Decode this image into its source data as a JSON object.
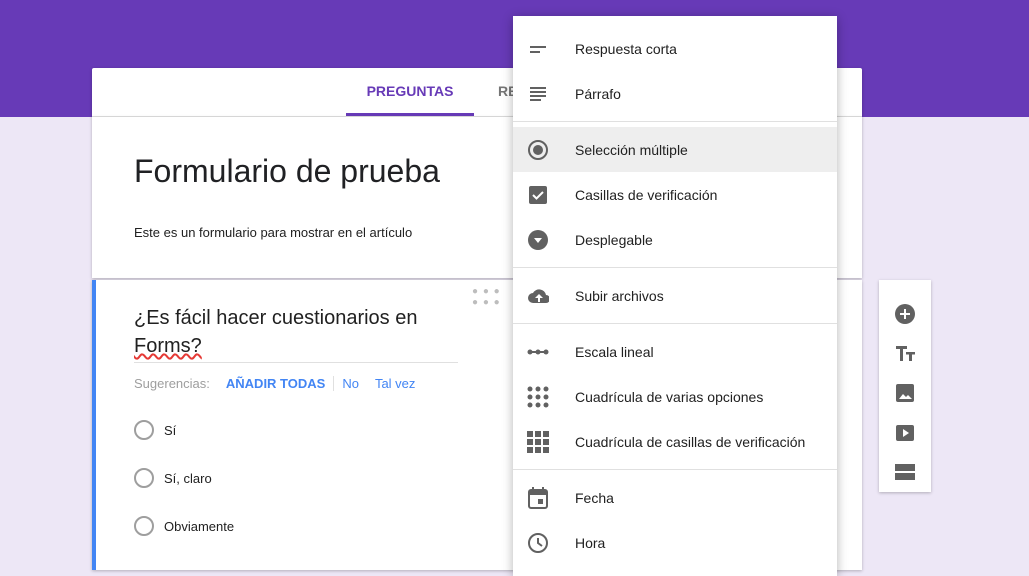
{
  "tabs": {
    "questions": "PREGUNTAS",
    "responses": "RE"
  },
  "form": {
    "title": "Formulario de prueba",
    "description": "Este es un formulario para mostrar en el artículo"
  },
  "question": {
    "title_part1": "¿Es fácil hacer cuestionarios en ",
    "title_part2": "Forms?",
    "suggestions_label": "Sugerencias:",
    "add_all": "AÑADIR TODAS",
    "suggestions": [
      "No",
      "Tal vez"
    ],
    "options": [
      "Sí",
      "Sí, claro",
      "Obviamente"
    ]
  },
  "menu": {
    "items": [
      "Respuesta corta",
      "Párrafo",
      "Selección múltiple",
      "Casillas de verificación",
      "Desplegable",
      "Subir archivos",
      "Escala lineal",
      "Cuadrícula de varias opciones",
      "Cuadrícula de casillas de verificación",
      "Fecha",
      "Hora"
    ],
    "selected": "Selección múltiple"
  },
  "colors": {
    "header": "#673ab7",
    "background": "#ede7f6",
    "accent_blue": "#4285f4"
  }
}
